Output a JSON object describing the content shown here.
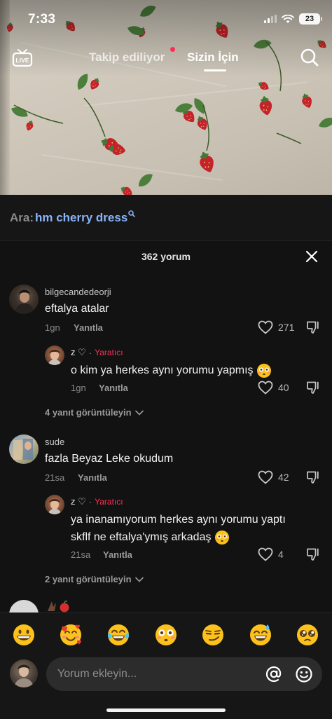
{
  "status_bar": {
    "time": "7:33",
    "battery": "23"
  },
  "top_nav": {
    "live_label": "LIVE",
    "tab_following": "Takip ediliyor",
    "tab_for_you": "Sizin İçin"
  },
  "search_strip": {
    "prefix": "Ara:",
    "query": "hm cherry dress"
  },
  "comments_panel": {
    "title": "362 yorum",
    "comments": [
      {
        "username": "bilgecandedeorji",
        "text": "eftalya atalar",
        "time": "1gn",
        "reply_label": "Yanıtla",
        "likes": "271",
        "reply": {
          "username": "z ♡",
          "separator": "·",
          "badge": "Yaratıcı",
          "text": "o kim ya herkes aynı yorumu yapmış",
          "time": "1gn",
          "reply_label": "Yanıtla",
          "likes": "40"
        },
        "view_replies": "4 yanıt görüntüleyin"
      },
      {
        "username": "sude",
        "text": "fazla Beyaz Leke okudum",
        "time": "21sa",
        "reply_label": "Yanıtla",
        "likes": "42",
        "reply": {
          "username": "z ♡",
          "separator": "·",
          "badge": "Yaratıcı",
          "text_line1": "ya inanamıyorum herkes aynı yorumu yaptı",
          "text_line2": "skflf ne eftalya'ymış arkadaş",
          "time": "21sa",
          "reply_label": "Yanıtla",
          "likes": "4"
        },
        "view_replies": "2 yanıt görüntüleyin"
      }
    ]
  },
  "emoji_bar": [
    "grinning-face",
    "smiling-face-with-hearts",
    "tears-of-joy",
    "flushed-face",
    "smirking-face",
    "grinning-face-with-sweat",
    "pleading-face"
  ],
  "comment_input": {
    "placeholder": "Yorum ekleyin..."
  },
  "colors": {
    "accent": "#fe2c55",
    "link": "#8ab4f8",
    "background": "#121212"
  }
}
